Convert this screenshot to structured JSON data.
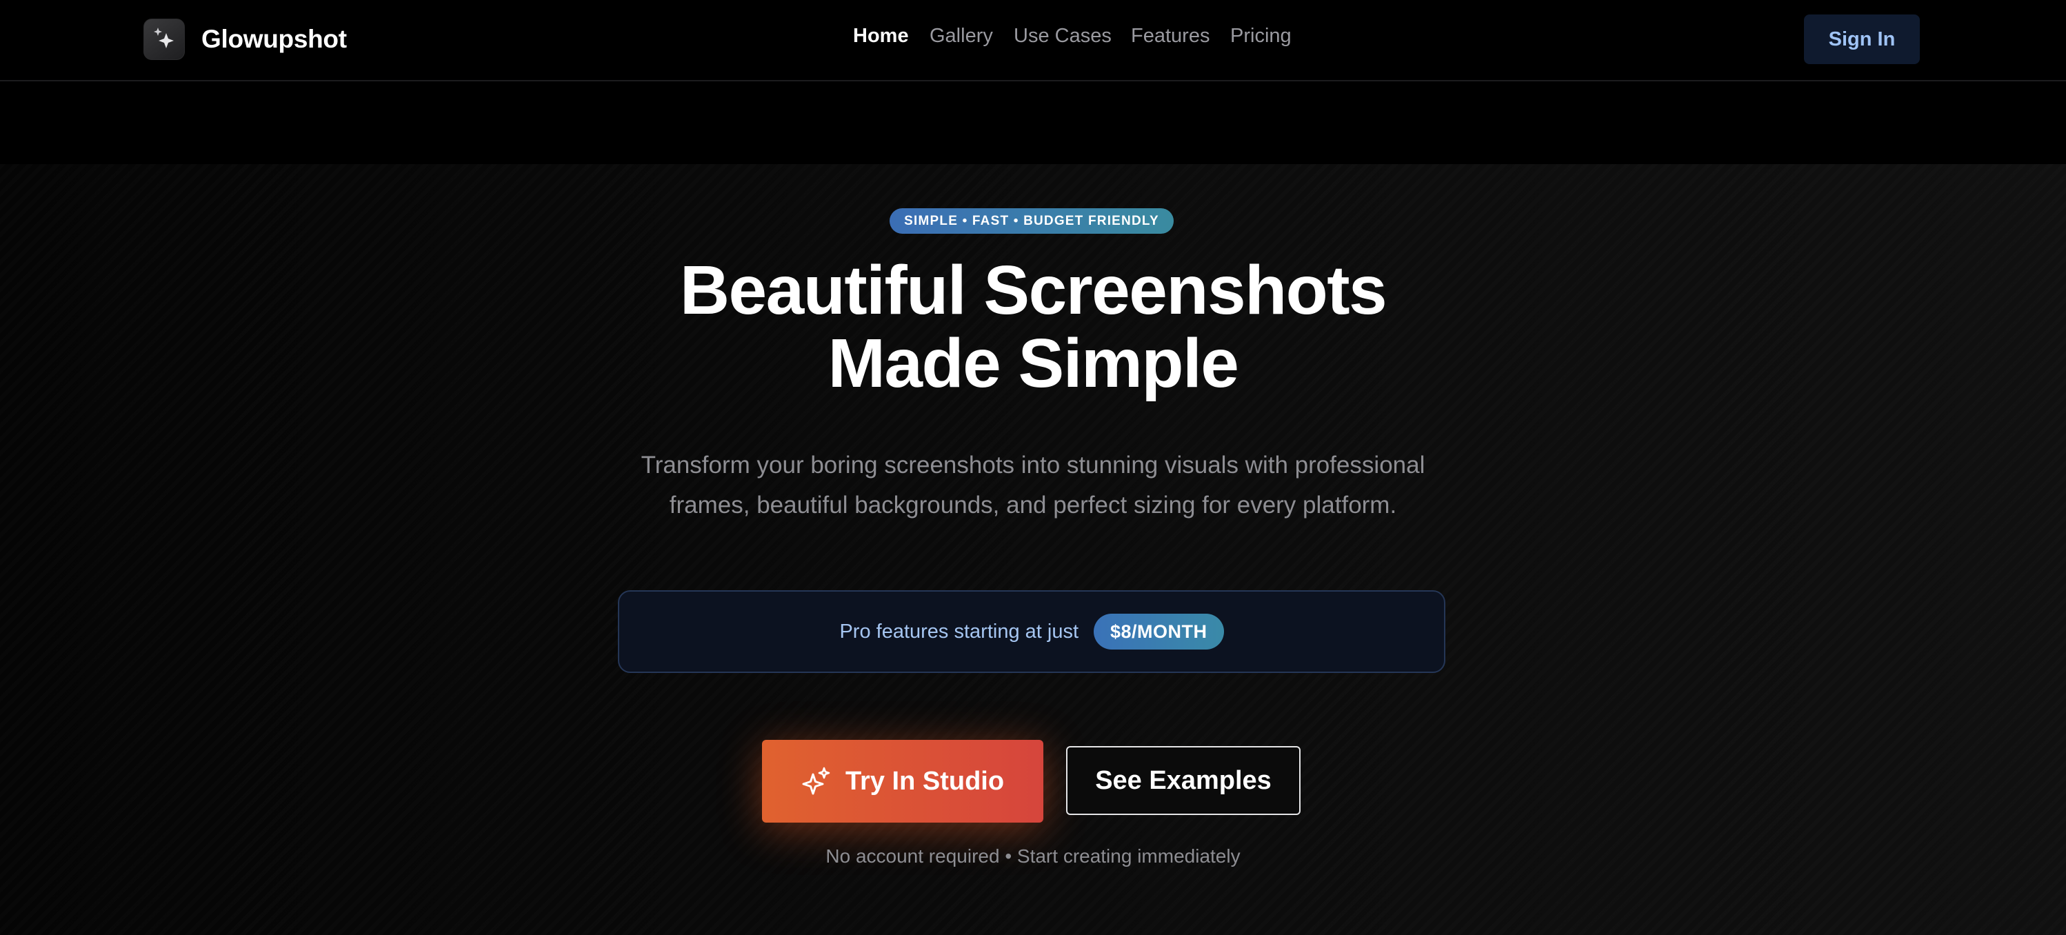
{
  "brand": {
    "name": "Glowupshot",
    "logo_icon": "sparkles-icon"
  },
  "nav": {
    "items": [
      {
        "label": "Home",
        "active": true
      },
      {
        "label": "Gallery",
        "active": false
      },
      {
        "label": "Use Cases",
        "active": false
      },
      {
        "label": "Features",
        "active": false
      },
      {
        "label": "Pricing",
        "active": false
      }
    ]
  },
  "header": {
    "signin_label": "Sign In"
  },
  "hero": {
    "badge": "SIMPLE • FAST • BUDGET FRIENDLY",
    "title_line1": "Beautiful Screenshots",
    "title_line2": "Made Simple",
    "subtitle_line1": "Transform your boring screenshots into stunning visuals with professional",
    "subtitle_line2": "frames, beautiful backgrounds, and perfect sizing for every platform.",
    "pro_text": "Pro features starting at just",
    "pro_price": "$8/MONTH",
    "cta_primary": "Try In Studio",
    "cta_primary_icon": "sparkles-icon",
    "cta_secondary": "See Examples",
    "note": "No account required • Start creating immediately"
  },
  "colors": {
    "background": "#000000",
    "accent_orange": "#e0622f",
    "accent_red": "#d6453c",
    "accent_blue": "#3b6eb5",
    "text_muted": "#8e8e93"
  }
}
